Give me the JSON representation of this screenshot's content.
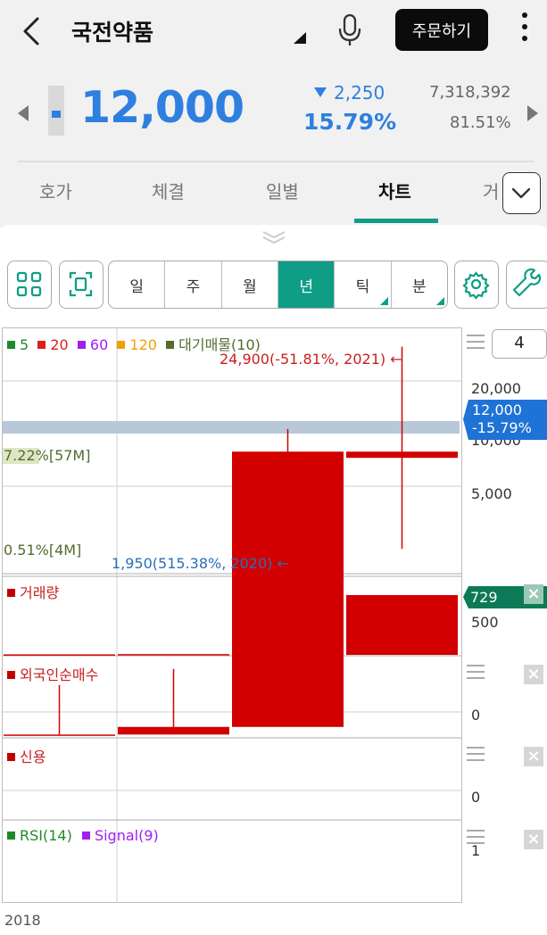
{
  "header": {
    "stock_name": "국전약품",
    "order_button": "주문하기"
  },
  "quote": {
    "price": "12,000",
    "change": "2,250",
    "change_pct": "15.79%",
    "volume": "7,318,392",
    "turnover_pct": "81.51%"
  },
  "tabs": [
    {
      "label": "호가"
    },
    {
      "label": "체결"
    },
    {
      "label": "일별"
    },
    {
      "label": "차트"
    },
    {
      "label": "거"
    }
  ],
  "periods": [
    {
      "label": "일"
    },
    {
      "label": "주"
    },
    {
      "label": "월"
    },
    {
      "label": "년"
    },
    {
      "label": "틱"
    },
    {
      "label": "분"
    }
  ],
  "chart_control": {
    "count_value": "4"
  },
  "price_panel": {
    "ma_legend": [
      {
        "label": "5",
        "color": "#1f8a2a"
      },
      {
        "label": "20",
        "color": "#e01e1e"
      },
      {
        "label": "60",
        "color": "#a020f0"
      },
      {
        "label": "120",
        "color": "#f0a000"
      },
      {
        "label": "대기매물(10)",
        "color": "#556b2f"
      }
    ],
    "high_label": "24,900(-51.81%, 2021)",
    "low_label": "1,950(515.38%, 2020)",
    "supply_top": "7.22%[57M]",
    "supply_bottom": "0.51%[4M]",
    "y_ticks": [
      "20,000",
      "10,000",
      "5,000"
    ],
    "price_tag": "12,000",
    "price_tag_pct": "-15.79%"
  },
  "panels": {
    "volume": {
      "label": "거래량",
      "tag": "729",
      "tick": "500"
    },
    "foreign": {
      "label": "외국인순매수",
      "tick": "0"
    },
    "credit": {
      "label": "신용",
      "tick": "0"
    },
    "rsi": {
      "label_rsi": "RSI(14)",
      "label_signal": "Signal(9)",
      "tick": "1"
    }
  },
  "x_axis_label": "2018",
  "chart_data": {
    "type": "bar",
    "candles": [
      {
        "open": 1950,
        "high": 2700,
        "low": 1950,
        "close": 1950
      },
      {
        "open": 1950,
        "high": 3000,
        "low": 1950,
        "close": 2050
      },
      {
        "open": 2050,
        "high": 14500,
        "low": 2050,
        "close": 12500
      },
      {
        "open": 12500,
        "high": 24900,
        "low": 6600,
        "close": 12000
      }
    ],
    "volume": [
      6,
      9,
      58,
      729
    ]
  },
  "colors": {
    "price_blue": "#2f7fe0",
    "accent_green": "#0f9e85",
    "candle_red": "#d20000",
    "volume_tag_green": "#0c7a56"
  }
}
